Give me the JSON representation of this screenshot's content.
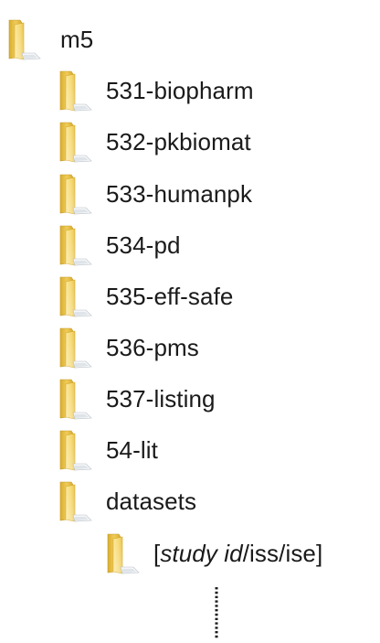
{
  "root": {
    "label": "m5",
    "icon": "folder-icon"
  },
  "children": [
    {
      "label": "531-biopharm",
      "icon": "folder-icon"
    },
    {
      "label": "532-pkbiomat",
      "icon": "folder-icon"
    },
    {
      "label": "533-humanpk",
      "icon": "folder-icon"
    },
    {
      "label": "534-pd",
      "icon": "folder-icon"
    },
    {
      "label": "535-eff-safe",
      "icon": "folder-icon"
    },
    {
      "label": "536-pms",
      "icon": "folder-icon"
    },
    {
      "label": "537-listing",
      "icon": "folder-icon"
    },
    {
      "label": "54-lit",
      "icon": "folder-icon"
    },
    {
      "label": "datasets",
      "icon": "folder-icon"
    }
  ],
  "datasets_child": {
    "label_open": "[",
    "label_italic": "study id",
    "label_rest": "/iss/ise]",
    "icon": "folder-icon"
  },
  "colors": {
    "folder_back": "#e8c24a",
    "folder_front": "#f7dc7a",
    "folder_highlight": "#fff3b8",
    "folder_shadow": "#c9a234",
    "text": "#1a1a1a",
    "dots": "#1a1a1a"
  }
}
